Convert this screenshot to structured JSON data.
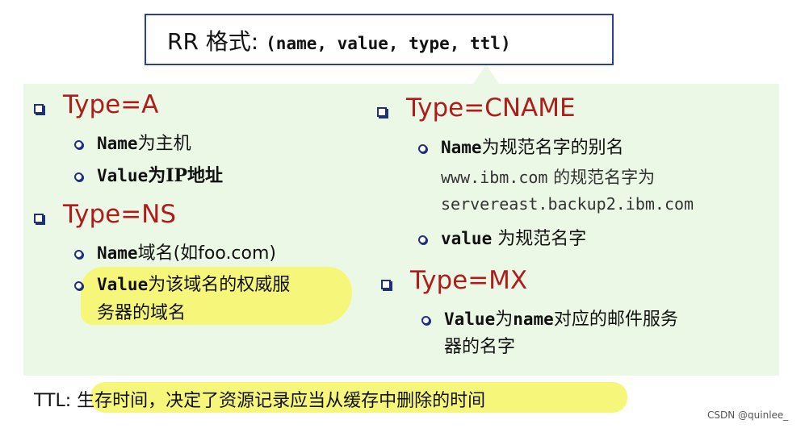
{
  "header": {
    "prefix": "RR 格式: ",
    "format": "(name, value, type, ttl)"
  },
  "left": {
    "type_a": {
      "title": "Type=A",
      "items": [
        {
          "bold": "Name",
          "text": "为主机"
        },
        {
          "bold": "Value",
          "text": "为IP地址"
        }
      ]
    },
    "type_ns": {
      "title": "Type=NS",
      "name_bold": "Name",
      "name_text": "域名(如foo.com)",
      "value_bold": "Value",
      "value_text_line1": "为该域名的权威服",
      "value_text_line2": "务器的域名"
    }
  },
  "right": {
    "type_cname": {
      "title": "Type=CNAME",
      "name_bold": "Name",
      "name_text": "为规范名字的别名",
      "example_line1_mono": "www.ibm.com",
      "example_line1_text": " 的规范名字为",
      "example_line2_mono": "servereast.backup2.ibm.com",
      "value_bold": "value",
      "value_text": " 为规范名字"
    },
    "type_mx": {
      "title": "Type=MX",
      "value_bold": "Value",
      "value_text_a": "为",
      "value_bold2": "name",
      "value_text_b": "对应的邮件服务",
      "value_line2": "器的名字"
    }
  },
  "footer": {
    "ttl_label": "TTL: ",
    "ttl_text": "生存时间，决定了资源记录应当从缓存中删除的时间"
  },
  "watermark": "CSDN @quinlee_",
  "colors": {
    "panel_bg": "#ecf8e6",
    "type_red": "#b01c1c",
    "bullet_navy": "#1f2f7a",
    "highlight_yellow": "#f6f77a",
    "box_border": "#2d3f9e"
  }
}
